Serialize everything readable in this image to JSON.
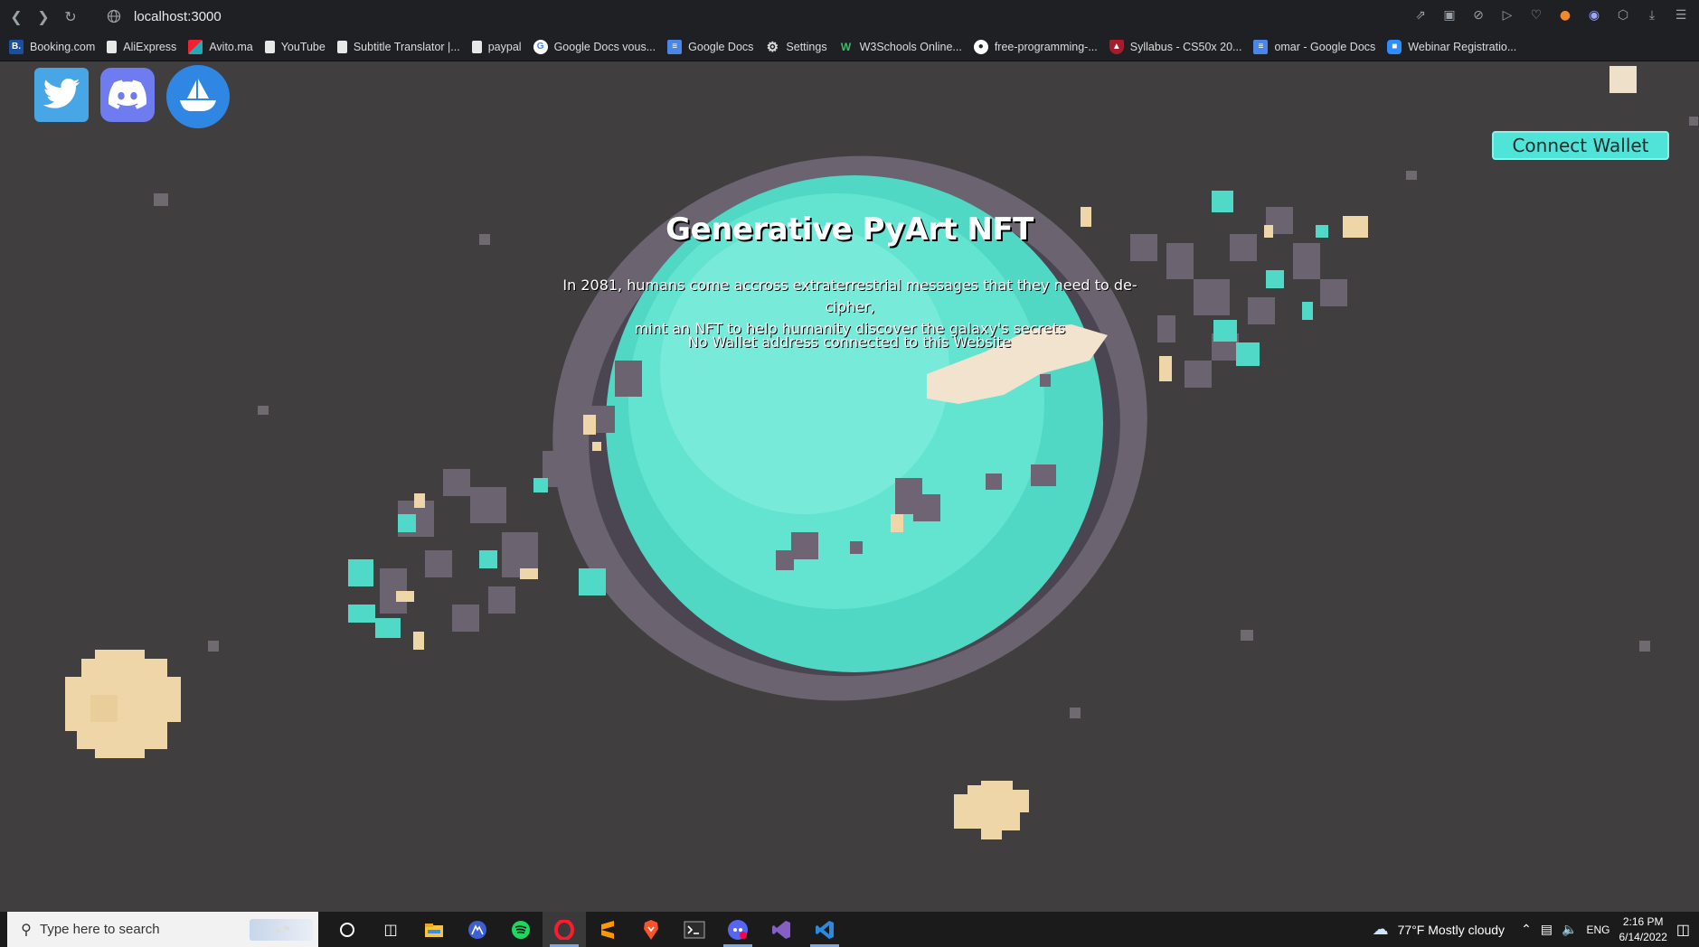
{
  "browser": {
    "url": "localhost:3000",
    "bookmarks": [
      {
        "label": "Booking.com",
        "icon": "booking-icon"
      },
      {
        "label": "AliExpress",
        "icon": "page-icon"
      },
      {
        "label": "Avito.ma",
        "icon": "avito-icon"
      },
      {
        "label": "YouTube",
        "icon": "page-icon"
      },
      {
        "label": "Subtitle Translator |...",
        "icon": "page-icon"
      },
      {
        "label": "paypal",
        "icon": "page-icon"
      },
      {
        "label": "Google Docs vous...",
        "icon": "google-icon"
      },
      {
        "label": "Google Docs",
        "icon": "docs-icon"
      },
      {
        "label": "Settings",
        "icon": "gear-icon"
      },
      {
        "label": "W3Schools Online...",
        "icon": "w3schools-icon"
      },
      {
        "label": "free-programming-...",
        "icon": "github-icon"
      },
      {
        "label": "Syllabus - CS50x 20...",
        "icon": "harvard-icon"
      },
      {
        "label": "omar - Google Docs",
        "icon": "docs-icon"
      },
      {
        "label": "Webinar Registratio...",
        "icon": "zoom-icon"
      }
    ]
  },
  "page": {
    "title": "Generative PyArt NFT",
    "description_line1": "In 2081, humans come accross extraterrestrial messages that they need to de-cipher,",
    "description_line2": "mint an NFT to help humanity discover the galaxy's secrets",
    "wallet_status": "No Wallet address connected to this Website",
    "connect_button": "Connect Wallet",
    "social": [
      "twitter-icon",
      "discord-icon",
      "opensea-icon"
    ]
  },
  "taskbar": {
    "search_placeholder": "Type here to search",
    "weather": "77°F  Mostly cloudy",
    "language": "ENG",
    "time": "2:16 PM",
    "date": "6/14/2022"
  },
  "colors": {
    "accent": "#4fe4d7",
    "planet": "#5fe3cc",
    "background": "#403e3f",
    "sand": "#efd6a8"
  }
}
